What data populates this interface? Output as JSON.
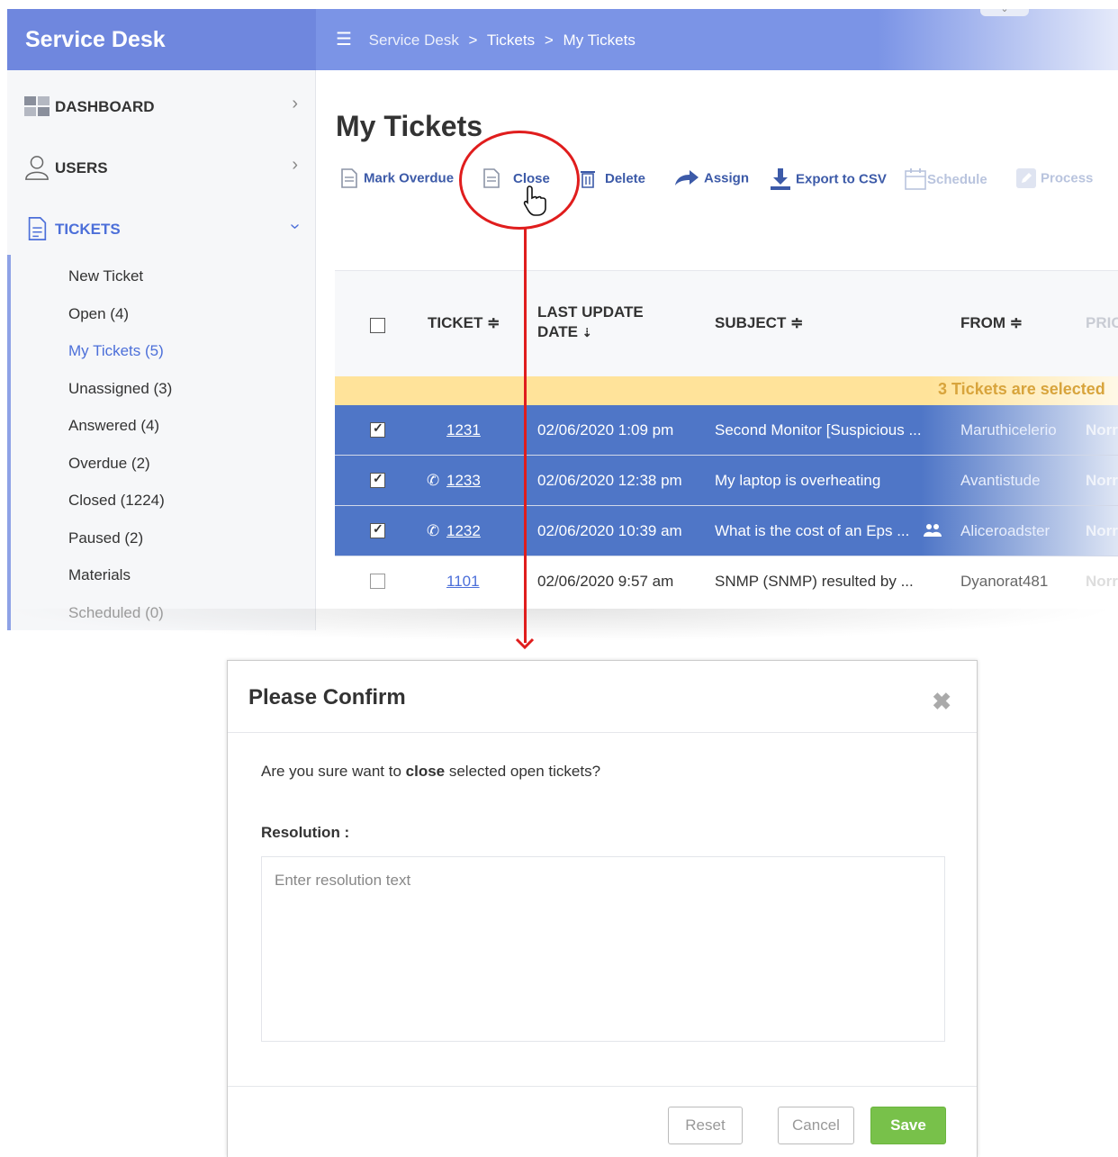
{
  "app": {
    "brand": "Service Desk",
    "breadcrumb": [
      "Service Desk",
      ">",
      "Tickets",
      ">",
      "My Tickets"
    ],
    "top_caret": "⌄"
  },
  "sidebar": {
    "items": [
      {
        "label": "DASHBOARD",
        "icon": "dashboard-icon"
      },
      {
        "label": "USERS",
        "icon": "user-icon"
      },
      {
        "label": "TICKETS",
        "icon": "document-icon"
      }
    ],
    "tickets_sub": [
      "New Ticket",
      "Open (4)",
      "My Tickets (5)",
      "Unassigned (3)",
      "Answered (4)",
      "Overdue (2)",
      "Closed (1224)",
      "Paused (2)",
      "Materials",
      "Scheduled (0)"
    ]
  },
  "main": {
    "title": "My Tickets",
    "toolbar": {
      "mark_overdue": "Mark Overdue",
      "close": "Close",
      "delete": "Delete",
      "assign": "Assign",
      "export": "Export to CSV",
      "schedule": "Schedule",
      "process": "Process"
    },
    "table": {
      "headers": {
        "ticket": "TICKET ≑",
        "last_update_1": "LAST UPDATE",
        "last_update_2": "DATE",
        "subject": "SUBJECT ≑",
        "from": "FROM ≑",
        "priority": "PRIC"
      },
      "selected_banner": "3 Tickets are selected",
      "rows": [
        {
          "ticket": "1231",
          "date": "02/06/2020 1:09 pm",
          "subject": "Second Monitor [Suspicious ...",
          "from": "Maruthicelerio",
          "priority": "Norr",
          "phone": "",
          "group": ""
        },
        {
          "ticket": "1233",
          "date": "02/06/2020 12:38 pm",
          "subject": "My laptop is overheating",
          "from": "Avantistude",
          "priority": "Norr",
          "phone": "✆",
          "group": ""
        },
        {
          "ticket": "1232",
          "date": "02/06/2020 10:39 am",
          "subject": "What is the cost of an Eps ...",
          "from": "Aliceroadster",
          "priority": "Norr",
          "phone": "✆",
          "group": "group-icon"
        },
        {
          "ticket": "1101",
          "date": "02/06/2020 9:57 am",
          "subject": "SNMP (SNMP) resulted by ...",
          "from": "Dyanorat481",
          "priority": "Norr",
          "phone": "",
          "group": ""
        }
      ]
    }
  },
  "modal": {
    "title": "Please Confirm",
    "close_glyph": "✖",
    "text_before": "Are you sure want to ",
    "text_bold": "close",
    "text_after": " selected open tickets?",
    "resolution_label": "Resolution :",
    "resolution_placeholder": "Enter resolution text",
    "reset": "Reset",
    "cancel": "Cancel",
    "save": "Save"
  },
  "colors": {
    "brand": "#6f87de",
    "selected_row": "#4f76c7",
    "banner": "#ffe39a",
    "annotation": "#e01d1d",
    "save": "#78c14a"
  }
}
